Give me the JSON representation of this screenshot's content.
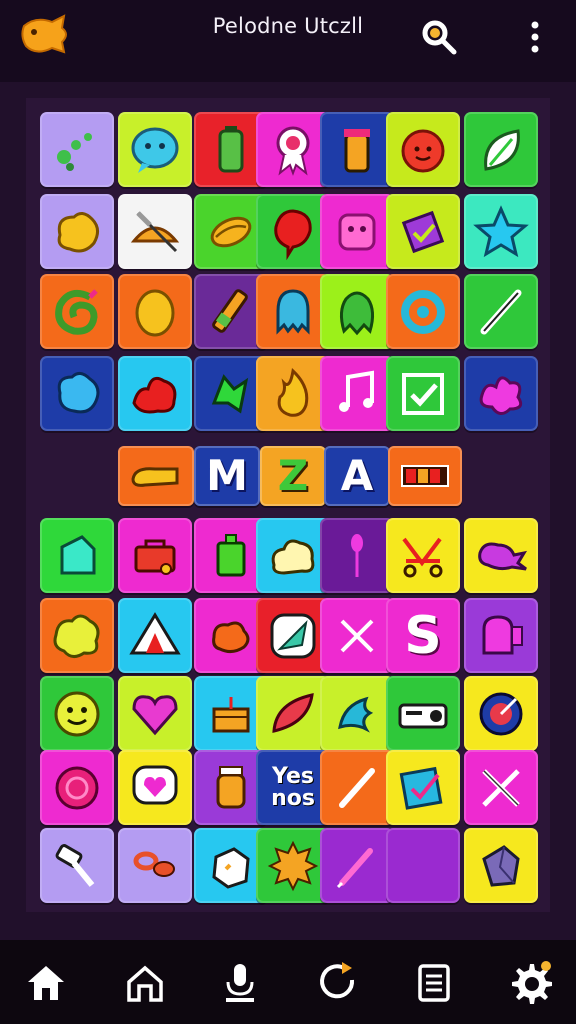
{
  "header": {
    "title": "Pelodne Utczll",
    "logo_icon": "fish-icon",
    "search_icon": "search-icon",
    "menu_icon": "more-vertical-icon"
  },
  "colors": {
    "background": "#21102b",
    "topbar": "#160a1e",
    "nav": "#0d070f"
  },
  "board": {
    "middle_row": {
      "letters": [
        "M",
        "Z",
        "A"
      ]
    },
    "tiles_text": {
      "s_letter": "S",
      "yes_line1": "Yes",
      "yes_line2": "nos"
    }
  },
  "bottom_nav": [
    {
      "icon": "home-icon"
    },
    {
      "icon": "house-outline-icon"
    },
    {
      "icon": "microphone-icon"
    },
    {
      "icon": "refresh-icon"
    },
    {
      "icon": "document-icon"
    },
    {
      "icon": "settings-gear-icon"
    }
  ]
}
